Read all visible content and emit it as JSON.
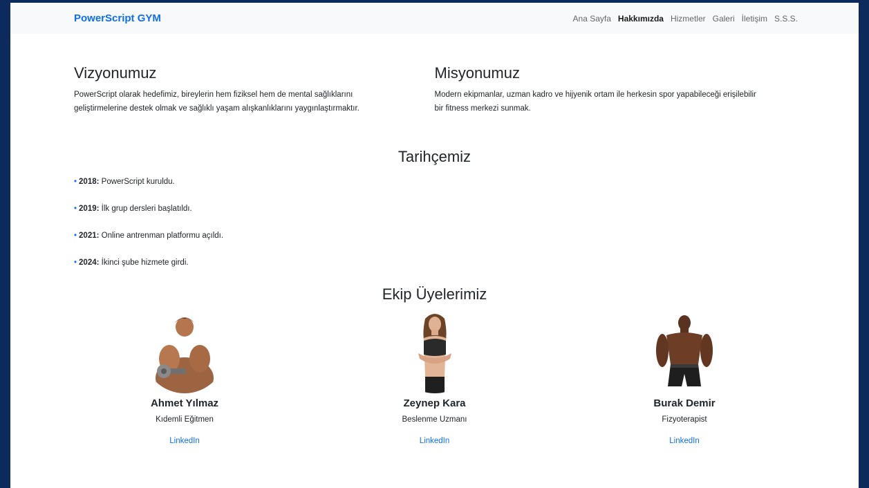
{
  "navbar": {
    "brand": "PowerScript GYM",
    "links": [
      {
        "label": "Ana Sayfa"
      },
      {
        "label": "Hakkımızda",
        "active": true
      },
      {
        "label": "Hizmetler"
      },
      {
        "label": "Galeri"
      },
      {
        "label": "İletişim"
      },
      {
        "label": "S.S.S."
      }
    ]
  },
  "vision": {
    "title": "Vizyonumuz",
    "text": "PowerScript olarak hedefimiz, bireylerin hem fiziksel hem de mental sağlıklarını geliştirmelerine destek olmak ve sağlıklı yaşam alışkanlıklarını yaygınlaştırmaktır."
  },
  "mission": {
    "title": "Misyonumuz",
    "text": "Modern ekipmanlar, uzman kadro ve hijyenik ortam ile herkesin spor yapabileceği erişilebilir bir fitness merkezi sunmak."
  },
  "history": {
    "title": "Tarihçemiz",
    "items": [
      {
        "year": "2018:",
        "text": " PowerScript kuruldu."
      },
      {
        "year": "2019:",
        "text": " İlk grup dersleri başlatıldı."
      },
      {
        "year": "2021:",
        "text": " Online antrenman platformu açıldı."
      },
      {
        "year": "2024:",
        "text": " İkinci şube hizmete girdi."
      }
    ]
  },
  "team": {
    "title": "Ekip Üyelerimiz",
    "members": [
      {
        "name": "Ahmet Yılmaz",
        "role": "Kıdemli Eğitmen",
        "link": "LinkedIn"
      },
      {
        "name": "Zeynep Kara",
        "role": "Beslenme Uzmanı",
        "link": "LinkedIn"
      },
      {
        "name": "Burak Demir",
        "role": "Fizyoterapist",
        "link": "LinkedIn"
      }
    ]
  },
  "colors": {
    "frame": "#0d2a5c",
    "brand": "#0d6efd",
    "navbar_bg": "#f8f9fa"
  }
}
